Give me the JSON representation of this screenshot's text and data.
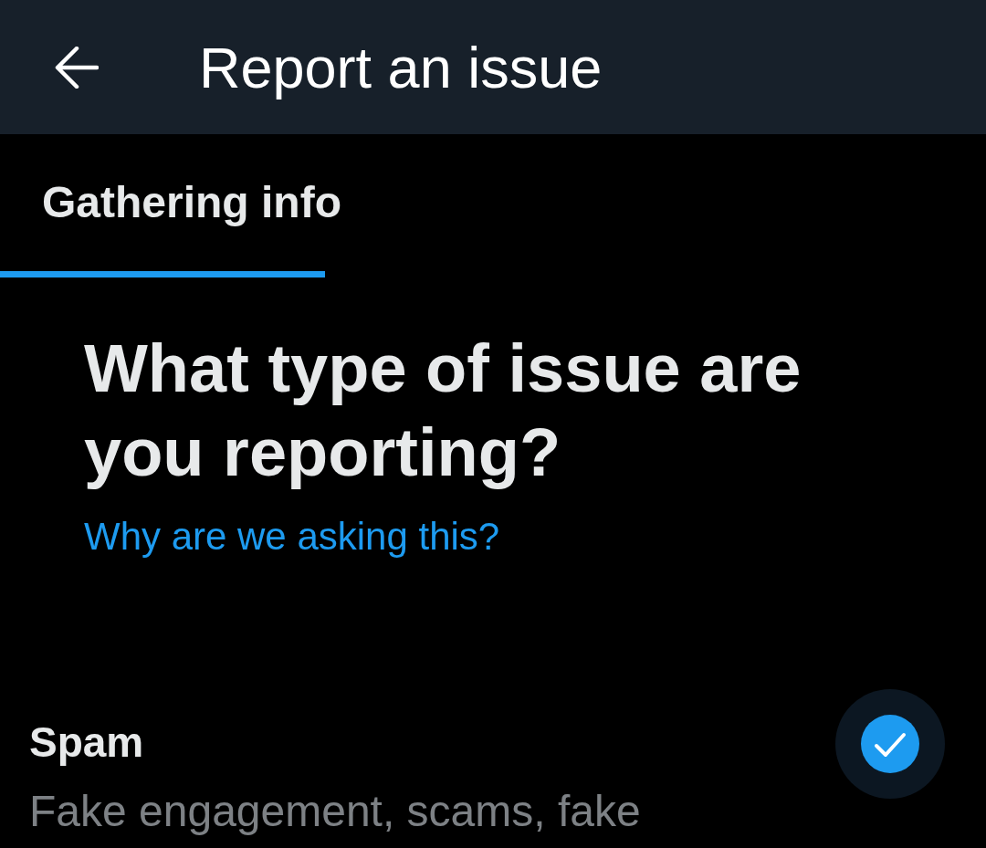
{
  "header": {
    "title": "Report an issue"
  },
  "progress": {
    "step": "Gathering info",
    "level": 0.33
  },
  "question": {
    "title": "What type of issue are you reporting?",
    "help_link": "Why are we asking this?"
  },
  "options": [
    {
      "label": "Spam",
      "description": "Fake engagement, scams, fake",
      "selected": true
    }
  ]
}
